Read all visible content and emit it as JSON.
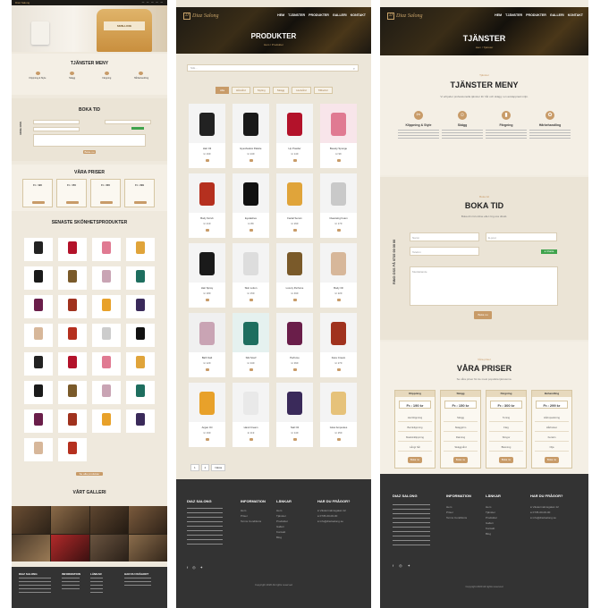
{
  "site": {
    "brand": "Diaz Salong",
    "nav": [
      "HEM",
      "TJÄNSTER",
      "PRODUKTER",
      "GALLERI",
      "KONTAKT"
    ]
  },
  "page1": {
    "hero_text": "",
    "services_title": "TJÄNSTER MENY",
    "services": [
      {
        "label": "Klippning & Style",
        "icon": "scissors-icon"
      },
      {
        "label": "Skägg",
        "icon": "beard-icon"
      },
      {
        "label": "Färgning",
        "icon": "bottle-icon"
      },
      {
        "label": "Hårbehandling",
        "icon": "treatment-icon"
      }
    ],
    "booking_title": "BOKA TID",
    "booking_side": "RING OSS",
    "booking_button": "Boka nu",
    "prices_title": "VÅRA PRISER",
    "prices": [
      "Fr.: 190",
      "Fr.: 150",
      "Fr.: 300",
      "Fr.: 299"
    ],
    "products_title": "SENASTE SKÖNHETSPRODUKTER",
    "more_button": "Se alla produkter",
    "gallery_title": "VÅRT GALLERI",
    "footer_heads": [
      "DIAZ SALONG",
      "INFORMATION",
      "LÄNKAR",
      "HAR DU FRÅGOR?"
    ]
  },
  "page2": {
    "title": "PRODUKTER",
    "subtitle": "Hem / Produkter",
    "search_placeholder": "Sök...",
    "filters": [
      "Alla",
      "Hårvård",
      "Styling",
      "Skägg",
      "Hudvård",
      "Tillbehör"
    ],
    "products": [
      {
        "name": "Hair Oil",
        "price": "kr 199"
      },
      {
        "name": "Eyeshadow Palette",
        "price": "kr 249"
      },
      {
        "name": "Lip Powder",
        "price": "kr 149"
      },
      {
        "name": "Beauty Sponge",
        "price": "kr 99"
      },
      {
        "name": "Body Scrub",
        "price": "kr 219"
      },
      {
        "name": "Eyelashes",
        "price": "kr 89"
      },
      {
        "name": "Facial Serum",
        "price": "kr 299"
      },
      {
        "name": "Cleansing Foam",
        "price": "kr 179"
      },
      {
        "name": "Hair Spray",
        "price": "kr 189"
      },
      {
        "name": "Skin Lotion",
        "price": "kr 159"
      },
      {
        "name": "Luxury Perfume",
        "price": "kr 499"
      },
      {
        "name": "Body Oil",
        "price": "kr 229"
      },
      {
        "name": "Bath Salt",
        "price": "kr 129"
      },
      {
        "name": "Silk Scarf",
        "price": "kr 349"
      },
      {
        "name": "Perfume",
        "price": "kr 399"
      },
      {
        "name": "Face Cream",
        "price": "kr 279"
      },
      {
        "name": "Argan Oil",
        "price": "kr 199"
      },
      {
        "name": "Hand Cream",
        "price": "kr 119"
      },
      {
        "name": "Nail Oil",
        "price": "kr 149"
      },
      {
        "name": "Glow Ampoules",
        "price": "kr 259"
      }
    ],
    "pagination": [
      "1",
      "2",
      "Nästa"
    ],
    "footer_heads": [
      "DIAZ SALONG",
      "INFORMATION",
      "LÄNKAR",
      "HAR DU FRÅGOR?"
    ],
    "footer_info": [
      "Hem",
      "Priser",
      "Terms Conditions"
    ],
    "footer_links": [
      "Hem",
      "Tjänster",
      "Produkter",
      "Galleri",
      "Kontakt",
      "Blog"
    ],
    "footer_contact": [
      "Västermalmsgatan 12",
      "0735-00-00-00",
      "info@diazsalong.se"
    ],
    "copyright": "Copyright 2020 All rights reserved"
  },
  "page3": {
    "title": "TJÄNSTER",
    "subtitle": "Hem / Tjänster",
    "kicker": "Tjänster",
    "services_title": "TJÄNSTER MENY",
    "services_desc": "Vi erbjuder professionella tjänster för hår och skägg i en avslappnad miljö.",
    "services": [
      {
        "label": "Klippning & Style",
        "icon": "scissors-icon"
      },
      {
        "label": "Skägg",
        "icon": "beard-icon"
      },
      {
        "label": "Färgning",
        "icon": "bottle-icon"
      },
      {
        "label": "Hårbehandling",
        "icon": "treatment-icon"
      }
    ],
    "booking_kicker": "Boka tid",
    "booking_title": "BOKA TID",
    "booking_desc": "Boka din tid online eller ring oss direkt.",
    "booking_side": "RING OSS PÅ 0735 00 00 00",
    "fields": {
      "name": "Namn",
      "email": "E-post",
      "phone": "Telefon",
      "message": "Meddelande"
    },
    "booking_button": "Boka nu",
    "chat_label": "Chatta",
    "prices_kicker": "Våra priser",
    "prices_title": "VÅRA PRISER",
    "prices_desc": "Se våra priser för de mest populära tjänsterna.",
    "price_cards": [
      {
        "head": "Klippning",
        "price": "Fr.: 190 kr",
        "items": [
          "Herrklippning",
          "Barnklippning",
          "Maskinklippning",
          "Långt hår"
        ],
        "button": "Boka nu"
      },
      {
        "head": "Skägg",
        "price": "Fr.: 150 kr",
        "items": [
          "Skägg",
          "Skäggtrim",
          "Rakning",
          "Skäggvård"
        ],
        "button": "Boka nu"
      },
      {
        "head": "Färgning",
        "price": "Fr.: 300 kr",
        "items": [
          "Toning",
          "Färg",
          "Slingor",
          "Blekning"
        ],
        "button": "Boka nu"
      },
      {
        "head": "Behandling",
        "price": "Fr.: 299 kr",
        "items": [
          "Hårinpackning",
          "Hårbotten",
          "Keratin",
          "Olja"
        ],
        "button": "Boka nu"
      }
    ],
    "footer_heads": [
      "DIAZ SALONG",
      "INFORMATION",
      "LÄNKAR",
      "HAR DU FRÅGOR?"
    ],
    "footer_info": [
      "Hem",
      "Priser",
      "Terms Conditions"
    ],
    "footer_links": [
      "Hem",
      "Tjänster",
      "Produkter",
      "Galleri",
      "Kontakt",
      "Blog"
    ],
    "footer_contact": [
      "Västermalmsgatan 12",
      "0735-00-00-00",
      "info@diazsalong.se"
    ],
    "copyright": "Copyright 2020 All rights reserved"
  },
  "colors": {
    "accent": "#c89b68",
    "dark": "#333333",
    "cream": "#efe9dd"
  }
}
